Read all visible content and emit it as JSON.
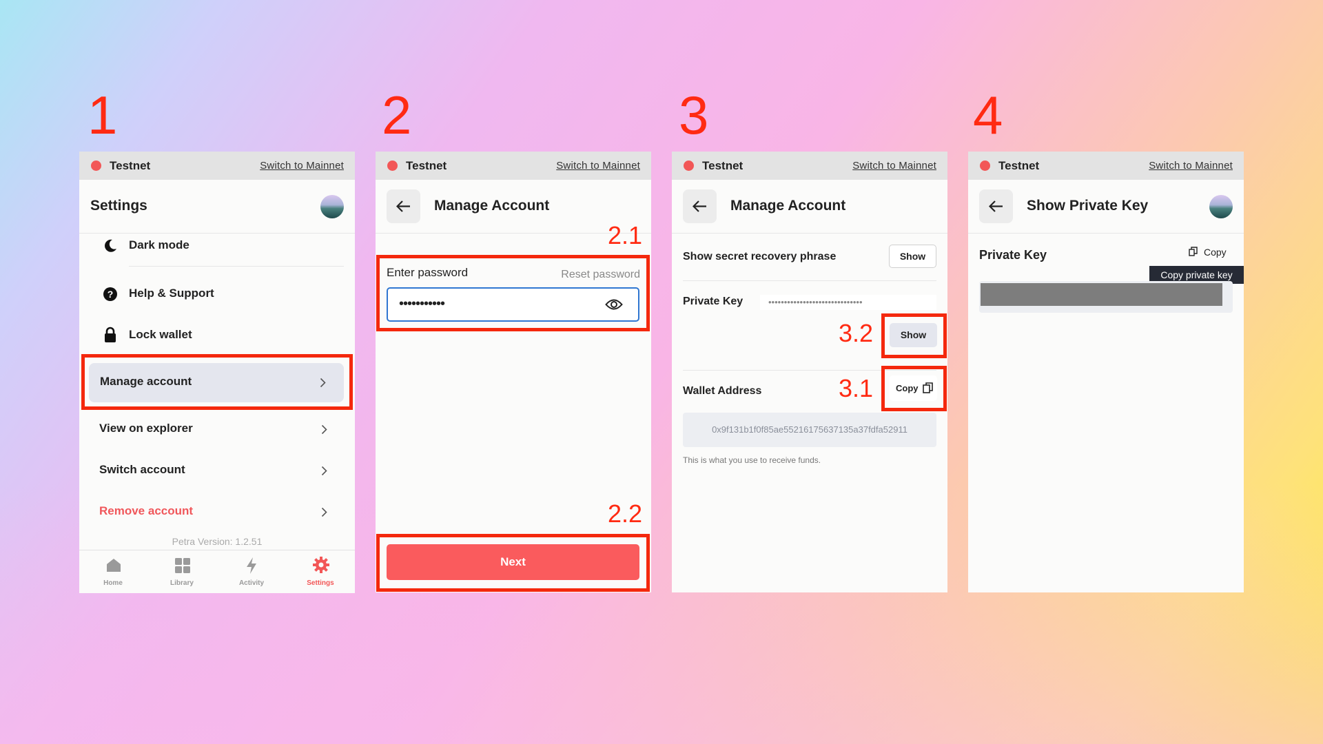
{
  "steps": [
    "1",
    "2",
    "3",
    "4"
  ],
  "network": {
    "name": "Testnet",
    "switch_label": "Switch to Mainnet"
  },
  "panel1": {
    "title": "Settings",
    "items": [
      {
        "label": "Dark mode",
        "icon": "moon-icon"
      },
      {
        "label": "Help & Support",
        "icon": "help-icon"
      },
      {
        "label": "Lock wallet",
        "icon": "lock-icon"
      },
      {
        "label": "Manage account",
        "icon": "chevron-right-icon"
      },
      {
        "label": "View on explorer",
        "icon": "chevron-right-icon"
      },
      {
        "label": "Switch account",
        "icon": "chevron-right-icon"
      },
      {
        "label": "Remove account",
        "icon": "chevron-right-icon"
      }
    ],
    "version": "Petra Version: 1.2.51",
    "nav": [
      {
        "label": "Home",
        "icon": "home-icon"
      },
      {
        "label": "Library",
        "icon": "grid-icon"
      },
      {
        "label": "Activity",
        "icon": "bolt-icon"
      },
      {
        "label": "Settings",
        "icon": "gear-icon"
      }
    ]
  },
  "panel2": {
    "title": "Manage Account",
    "password_label": "Enter password",
    "reset_label": "Reset password",
    "password_value": "•••••••••••",
    "next_label": "Next",
    "annot_1": "2.1",
    "annot_2": "2.2"
  },
  "panel3": {
    "title": "Manage Account",
    "secret_label": "Show secret recovery phrase",
    "show_label": "Show",
    "pk_label": "Private Key",
    "pk_dots": "••••••••••••••••••••••••••••••",
    "show2_label": "Show",
    "wallet_label": "Wallet Address",
    "copy_label": "Copy",
    "address": "0x9f131b1f0f85ae55216175637135a37fdfa52911",
    "hint": "This is what you use to receive funds.",
    "annot_1": "3.1",
    "annot_2": "3.2"
  },
  "panel4": {
    "title": "Show Private Key",
    "pk_label": "Private Key",
    "copy_label": "Copy",
    "tooltip": "Copy private key"
  },
  "colors": {
    "accent_red": "#f25757",
    "annotation_red": "#f4280d",
    "next_button": "#fa5b5d",
    "remove_text": "#f0575b"
  }
}
